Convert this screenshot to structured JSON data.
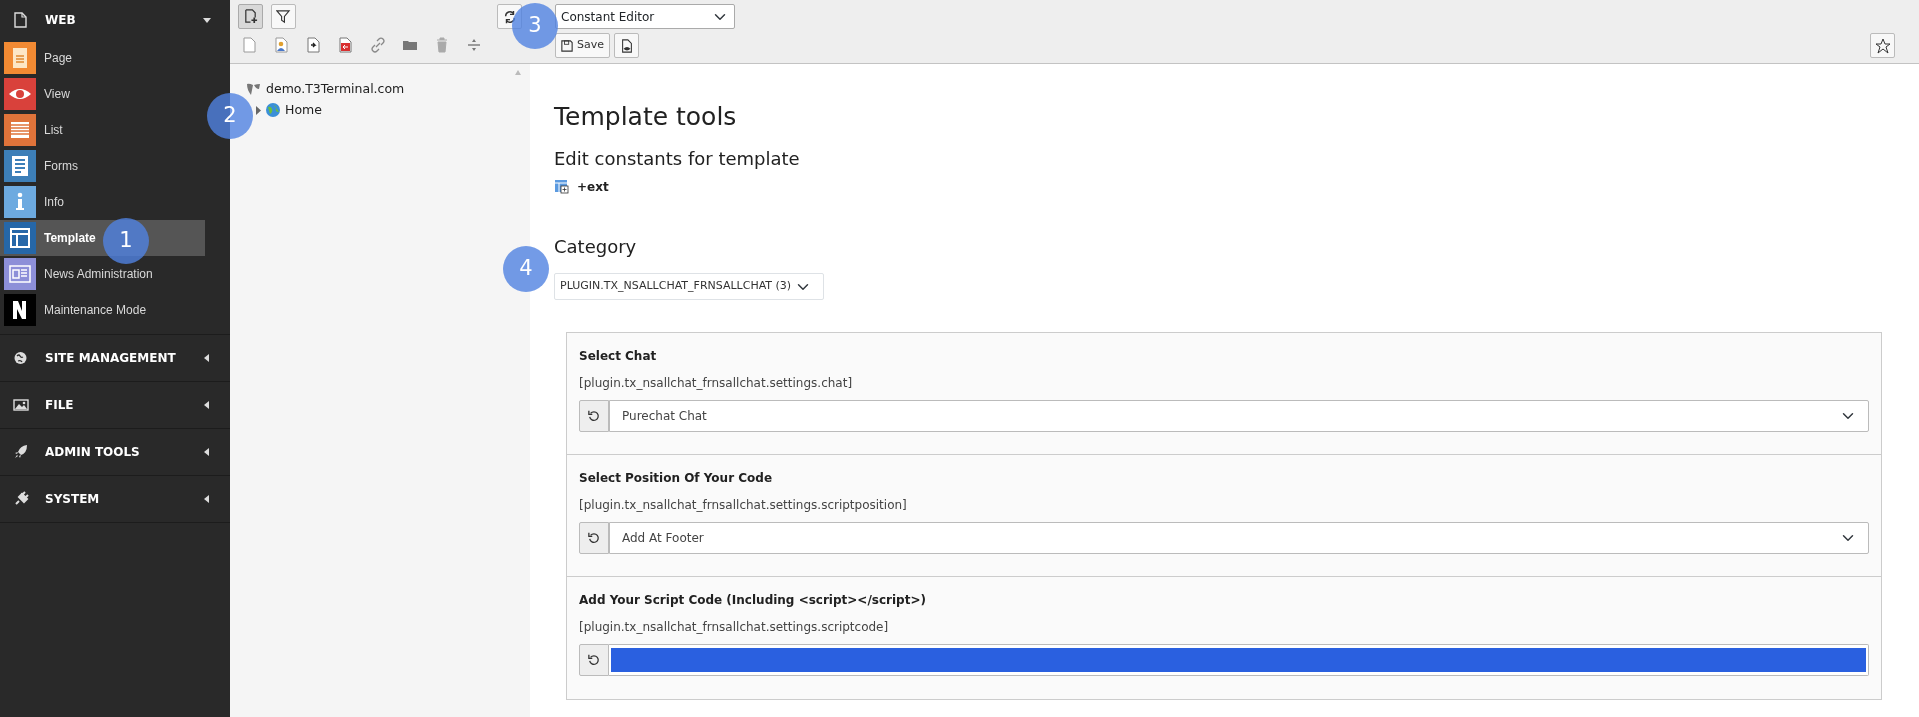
{
  "sidebar": {
    "groups": [
      {
        "label": "WEB",
        "expanded": true,
        "items": [
          {
            "label": "Page",
            "color": "#f28a33",
            "selected": false
          },
          {
            "label": "View",
            "color": "#d9413b",
            "selected": false
          },
          {
            "label": "List",
            "color": "#e0733a",
            "selected": false
          },
          {
            "label": "Forms",
            "color": "#3d7fb8",
            "selected": false
          },
          {
            "label": "Info",
            "color": "#6daae0",
            "selected": false
          },
          {
            "label": "Template",
            "color": "#2667a8",
            "selected": true
          },
          {
            "label": "News Administration",
            "color": "#8d8fd8",
            "selected": false
          },
          {
            "label": "Maintenance Mode",
            "color": "#000000",
            "selected": false
          }
        ]
      },
      {
        "label": "SITE MANAGEMENT",
        "expanded": false
      },
      {
        "label": "FILE",
        "expanded": false
      },
      {
        "label": "ADMIN TOOLS",
        "expanded": false
      },
      {
        "label": "SYSTEM",
        "expanded": false
      }
    ]
  },
  "tree_toolbar": {
    "buttons": [
      {
        "selected": true
      },
      {
        "selected": false
      }
    ]
  },
  "tree": {
    "root": "demo.T3Terminal.com",
    "children": [
      {
        "label": "Home",
        "expanded": false
      }
    ]
  },
  "doc_header": {
    "module_select": {
      "value": "Constant Editor"
    },
    "save_button": "Save"
  },
  "content": {
    "title": "Template tools",
    "subtitle": "Edit constants for template",
    "template": "+ext",
    "category_label": "Category",
    "category_select": {
      "value": "PLUGIN.TX_NSALLCHAT_FRNSALLCHAT (3)"
    },
    "fields": [
      {
        "title": "Select Chat",
        "path": "[plugin.tx_nsallchat_frnsallchat.settings.chat]",
        "kind": "select",
        "value": "Purechat Chat"
      },
      {
        "title": "Select Position Of Your Code",
        "path": "[plugin.tx_nsallchat_frnsallchat.settings.scriptposition]",
        "kind": "select",
        "value": "Add At Footer"
      },
      {
        "title": "Add Your Script Code (Including <script></script>)",
        "path": "[plugin.tx_nsallchat_frnsallchat.settings.scriptcode]",
        "kind": "text",
        "highlighted": true
      }
    ]
  },
  "callouts": [
    {
      "label": "1"
    },
    {
      "label": "2"
    },
    {
      "label": "3"
    },
    {
      "label": "4"
    }
  ]
}
